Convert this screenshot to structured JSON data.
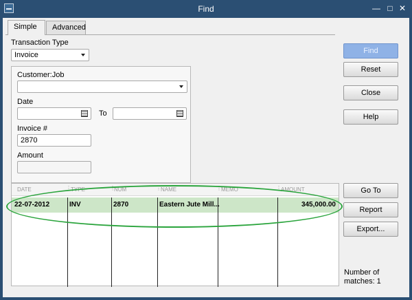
{
  "window": {
    "title": "Find"
  },
  "tabs": [
    {
      "label": "Simple"
    },
    {
      "label": "Advanced"
    }
  ],
  "filters": {
    "transaction_type": {
      "label": "Transaction Type",
      "value": "Invoice"
    },
    "customer_job": {
      "label": "Customer:Job",
      "value": ""
    },
    "date": {
      "label": "Date",
      "from": "",
      "to_label": "To",
      "to": ""
    },
    "invoice_no": {
      "label": "Invoice #",
      "value": "2870"
    },
    "amount": {
      "label": "Amount",
      "value": ""
    }
  },
  "buttons": {
    "find": "Find",
    "reset": "Reset",
    "close": "Close",
    "help": "Help",
    "goto": "Go To",
    "report": "Report",
    "export": "Export..."
  },
  "results": {
    "columns": [
      "DATE",
      "TYPE",
      "NUM",
      "NAME",
      "MEMO",
      "AMOUNT"
    ],
    "rows": [
      {
        "date": "22-07-2012",
        "type": "INV",
        "num": "2870",
        "name": "Eastern Jute Mill...",
        "memo": "",
        "amount": "345,000.00"
      }
    ]
  },
  "matches": {
    "label": "Number of",
    "count_text": "matches: 1"
  },
  "colors": {
    "titlebar": "#2b4f73",
    "row_highlight": "#cde6c8",
    "annotation_ellipse": "#2aa43c",
    "find_button": "#8fb2e6"
  }
}
